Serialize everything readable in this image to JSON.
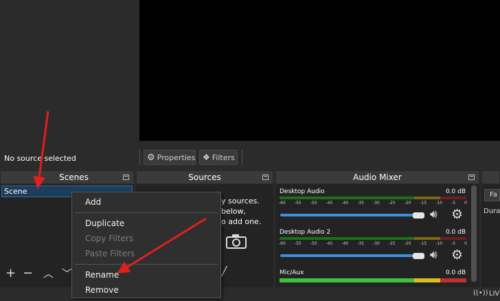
{
  "toolbar": {
    "no_source_text": "No source selected",
    "properties_label": "Properties",
    "filters_label": "Filters"
  },
  "docks": {
    "scenes_title": "Scenes",
    "sources_title": "Sources",
    "audio_mixer_title": "Audio Mixer"
  },
  "scenes": {
    "items": [
      "Scene"
    ]
  },
  "sources": {
    "hint_line1": "y sources.",
    "hint_line2": "below,",
    "hint_line3": "o add one."
  },
  "context_menu": {
    "items": [
      {
        "label": "Add",
        "enabled": true
      },
      {
        "label": "Duplicate",
        "enabled": true
      },
      {
        "label": "Copy Filters",
        "enabled": false
      },
      {
        "label": "Paste Filters",
        "enabled": false
      },
      {
        "label": "Rename",
        "enabled": true
      },
      {
        "label": "Remove",
        "enabled": true
      }
    ]
  },
  "mixer": {
    "scale_ticks": [
      "-60",
      "-55",
      "-50",
      "-45",
      "-40",
      "-35",
      "-30",
      "-25",
      "-20",
      "-15",
      "-10",
      "-5",
      "0"
    ],
    "channels": [
      {
        "name": "Desktop Audio",
        "db": "0.0 dB",
        "volume": 1.0
      },
      {
        "name": "Desktop Audio 2",
        "db": "0.0 dB",
        "volume": 1.0
      },
      {
        "name": "Mic/Aux",
        "db": "0.0 dB",
        "volume": 1.0
      }
    ]
  },
  "controls_panel": {
    "partial_label_1": "Fa",
    "partial_label_2": "Dura"
  },
  "status": {
    "live_partial": "LIV"
  },
  "colors": {
    "annotation_arrow": "#e02020",
    "selection": "#1d3d5c",
    "slider": "#3b8fe0"
  }
}
